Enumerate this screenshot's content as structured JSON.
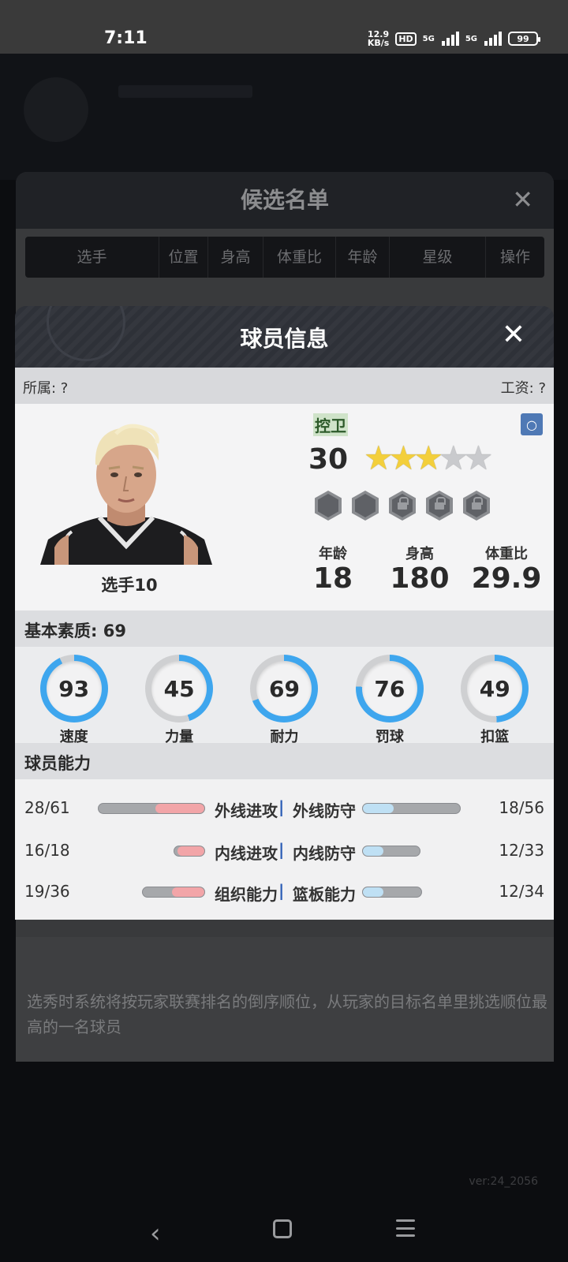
{
  "status_bar": {
    "time": "7:11",
    "net_speed_value": "12.9",
    "net_speed_unit": "KB/s",
    "hd_label": "HD",
    "sim1_label": "5G",
    "sim2_label": "5G",
    "battery": "99"
  },
  "candidate_list": {
    "title": "候选名单",
    "columns": [
      "选手",
      "位置",
      "身高",
      "体重比",
      "年龄",
      "星级",
      "操作"
    ],
    "note": "选秀时系统将按玩家联赛排名的倒序顺位，从玩家的目标名单里挑选顺位最高的一名球员"
  },
  "player_dialog": {
    "title": "球员信息",
    "affiliation": "所属: ?",
    "salary": "工资: ?",
    "player_name": "选手10",
    "position": "控卫",
    "rating": "30",
    "stars_filled": 3,
    "stars_total": 5,
    "vitals": [
      {
        "label": "年龄",
        "value": "18"
      },
      {
        "label": "身高",
        "value": "180"
      },
      {
        "label": "体重比",
        "value": "29.9"
      }
    ],
    "basic_quality_label": "基本素质: 69",
    "basic_stats": [
      {
        "label": "速度",
        "value": "93"
      },
      {
        "label": "力量",
        "value": "45"
      },
      {
        "label": "耐力",
        "value": "69"
      },
      {
        "label": "罚球",
        "value": "76"
      },
      {
        "label": "扣篮",
        "value": "49"
      }
    ],
    "ability_label": "球员能力",
    "abilities": [
      {
        "left_value": "28/61",
        "left_label": "外线进攻",
        "separator": "|",
        "right_label": "外线防守",
        "right_value": "18/56"
      },
      {
        "left_value": "16/18",
        "left_label": "内线进攻",
        "separator": "|",
        "right_label": "内线防守",
        "right_value": "12/33"
      },
      {
        "left_value": "19/36",
        "left_label": "组织能力",
        "separator": "|",
        "right_label": "篮板能力",
        "right_value": "12/34"
      }
    ]
  },
  "version": "ver:24_2056",
  "colors": {
    "gauge_blue": "#3ea6ee",
    "gauge_track": "#cfd0d2",
    "star_gold": "#f3cf3b",
    "attack_bar": "#f2a5a8",
    "defense_bar": "#bfe0f4",
    "position_tag": "#cfe3c9"
  }
}
